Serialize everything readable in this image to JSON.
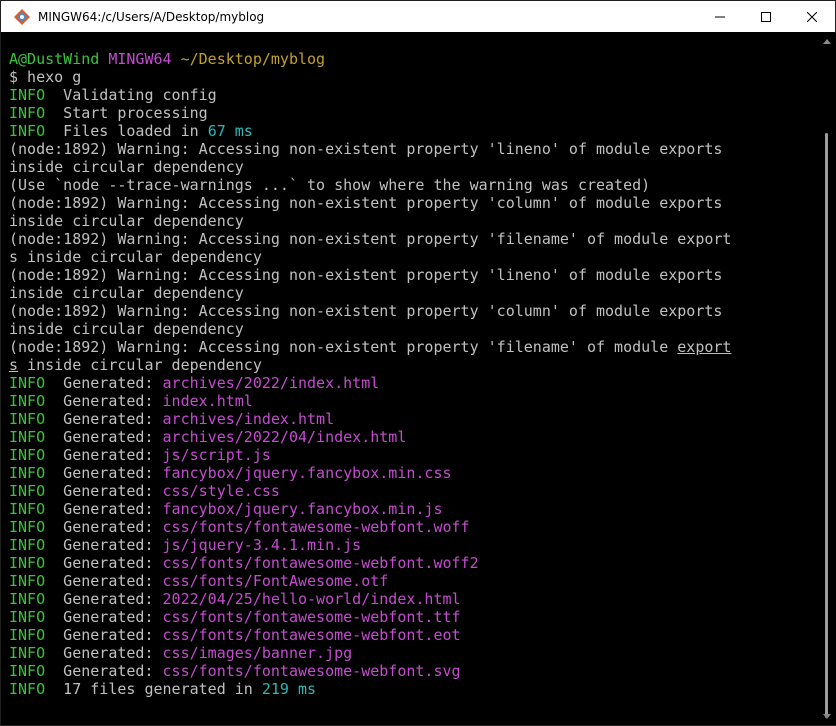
{
  "window": {
    "title": "MINGW64:/c/Users/A/Desktop/myblog"
  },
  "prompt": {
    "user_host": "A@DustWind",
    "system": "MINGW64",
    "path": "~/Desktop/myblog",
    "command": "$ hexo g"
  },
  "info_lines": {
    "tag": "INFO",
    "validating": "  Validating config",
    "start": "  Start processing",
    "files_loaded_text": "  Files loaded in ",
    "files_loaded_value": "67 ms"
  },
  "warnings": [
    "(node:1892) Warning: Accessing non-existent property 'lineno' of module exports",
    "inside circular dependency",
    "(Use `node --trace-warnings ...` to show where the warning was created)",
    "(node:1892) Warning: Accessing non-existent property 'column' of module exports",
    "inside circular dependency",
    "(node:1892) Warning: Accessing non-existent property 'filename' of module export",
    "s inside circular dependency",
    "(node:1892) Warning: Accessing non-existent property 'lineno' of module exports",
    "inside circular dependency",
    "(node:1892) Warning: Accessing non-existent property 'column' of module exports",
    "inside circular dependency"
  ],
  "last_warning": {
    "prefix": "(node:1892) Warning: Accessing non-existent property 'filename' of module ",
    "underlined": "export",
    "line2_underlined": "s",
    "line2_rest": " inside circular dependency"
  },
  "generated": {
    "label": "  Generated: ",
    "files": [
      "archives/2022/index.html",
      "index.html",
      "archives/index.html",
      "archives/2022/04/index.html",
      "js/script.js",
      "fancybox/jquery.fancybox.min.css",
      "css/style.css",
      "fancybox/jquery.fancybox.min.js",
      "css/fonts/fontawesome-webfont.woff",
      "js/jquery-3.4.1.min.js",
      "css/fonts/fontawesome-webfont.woff2",
      "css/fonts/FontAwesome.otf",
      "2022/04/25/hello-world/index.html",
      "css/fonts/fontawesome-webfont.ttf",
      "css/fonts/fontawesome-webfont.eot",
      "css/images/banner.jpg",
      "css/fonts/fontawesome-webfont.svg"
    ]
  },
  "summary": {
    "text": "  17 files generated in ",
    "value": "219 ms"
  },
  "colors": {
    "info_green": "#3ac33a",
    "path_purple": "#c54bd0",
    "path_yellow": "#c3a02c",
    "time_cyan": "#2fb7b7",
    "text_gray": "#c0c0c0"
  }
}
